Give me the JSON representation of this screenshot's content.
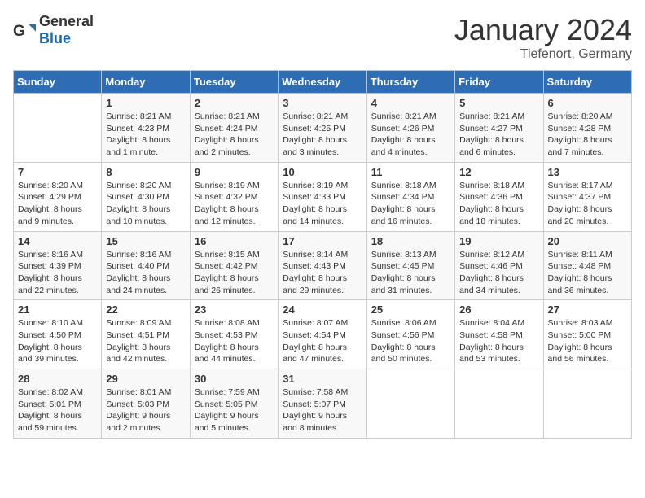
{
  "header": {
    "logo": {
      "general": "General",
      "blue": "Blue"
    },
    "title": "January 2024",
    "subtitle": "Tiefenort, Germany"
  },
  "weekdays": [
    "Sunday",
    "Monday",
    "Tuesday",
    "Wednesday",
    "Thursday",
    "Friday",
    "Saturday"
  ],
  "weeks": [
    [
      {
        "day": "",
        "sunrise": "",
        "sunset": "",
        "daylight": "",
        "empty": true
      },
      {
        "day": "1",
        "sunrise": "Sunrise: 8:21 AM",
        "sunset": "Sunset: 4:23 PM",
        "daylight": "Daylight: 8 hours and 1 minute."
      },
      {
        "day": "2",
        "sunrise": "Sunrise: 8:21 AM",
        "sunset": "Sunset: 4:24 PM",
        "daylight": "Daylight: 8 hours and 2 minutes."
      },
      {
        "day": "3",
        "sunrise": "Sunrise: 8:21 AM",
        "sunset": "Sunset: 4:25 PM",
        "daylight": "Daylight: 8 hours and 3 minutes."
      },
      {
        "day": "4",
        "sunrise": "Sunrise: 8:21 AM",
        "sunset": "Sunset: 4:26 PM",
        "daylight": "Daylight: 8 hours and 4 minutes."
      },
      {
        "day": "5",
        "sunrise": "Sunrise: 8:21 AM",
        "sunset": "Sunset: 4:27 PM",
        "daylight": "Daylight: 8 hours and 6 minutes."
      },
      {
        "day": "6",
        "sunrise": "Sunrise: 8:20 AM",
        "sunset": "Sunset: 4:28 PM",
        "daylight": "Daylight: 8 hours and 7 minutes."
      }
    ],
    [
      {
        "day": "7",
        "sunrise": "Sunrise: 8:20 AM",
        "sunset": "Sunset: 4:29 PM",
        "daylight": "Daylight: 8 hours and 9 minutes."
      },
      {
        "day": "8",
        "sunrise": "Sunrise: 8:20 AM",
        "sunset": "Sunset: 4:30 PM",
        "daylight": "Daylight: 8 hours and 10 minutes."
      },
      {
        "day": "9",
        "sunrise": "Sunrise: 8:19 AM",
        "sunset": "Sunset: 4:32 PM",
        "daylight": "Daylight: 8 hours and 12 minutes."
      },
      {
        "day": "10",
        "sunrise": "Sunrise: 8:19 AM",
        "sunset": "Sunset: 4:33 PM",
        "daylight": "Daylight: 8 hours and 14 minutes."
      },
      {
        "day": "11",
        "sunrise": "Sunrise: 8:18 AM",
        "sunset": "Sunset: 4:34 PM",
        "daylight": "Daylight: 8 hours and 16 minutes."
      },
      {
        "day": "12",
        "sunrise": "Sunrise: 8:18 AM",
        "sunset": "Sunset: 4:36 PM",
        "daylight": "Daylight: 8 hours and 18 minutes."
      },
      {
        "day": "13",
        "sunrise": "Sunrise: 8:17 AM",
        "sunset": "Sunset: 4:37 PM",
        "daylight": "Daylight: 8 hours and 20 minutes."
      }
    ],
    [
      {
        "day": "14",
        "sunrise": "Sunrise: 8:16 AM",
        "sunset": "Sunset: 4:39 PM",
        "daylight": "Daylight: 8 hours and 22 minutes."
      },
      {
        "day": "15",
        "sunrise": "Sunrise: 8:16 AM",
        "sunset": "Sunset: 4:40 PM",
        "daylight": "Daylight: 8 hours and 24 minutes."
      },
      {
        "day": "16",
        "sunrise": "Sunrise: 8:15 AM",
        "sunset": "Sunset: 4:42 PM",
        "daylight": "Daylight: 8 hours and 26 minutes."
      },
      {
        "day": "17",
        "sunrise": "Sunrise: 8:14 AM",
        "sunset": "Sunset: 4:43 PM",
        "daylight": "Daylight: 8 hours and 29 minutes."
      },
      {
        "day": "18",
        "sunrise": "Sunrise: 8:13 AM",
        "sunset": "Sunset: 4:45 PM",
        "daylight": "Daylight: 8 hours and 31 minutes."
      },
      {
        "day": "19",
        "sunrise": "Sunrise: 8:12 AM",
        "sunset": "Sunset: 4:46 PM",
        "daylight": "Daylight: 8 hours and 34 minutes."
      },
      {
        "day": "20",
        "sunrise": "Sunrise: 8:11 AM",
        "sunset": "Sunset: 4:48 PM",
        "daylight": "Daylight: 8 hours and 36 minutes."
      }
    ],
    [
      {
        "day": "21",
        "sunrise": "Sunrise: 8:10 AM",
        "sunset": "Sunset: 4:50 PM",
        "daylight": "Daylight: 8 hours and 39 minutes."
      },
      {
        "day": "22",
        "sunrise": "Sunrise: 8:09 AM",
        "sunset": "Sunset: 4:51 PM",
        "daylight": "Daylight: 8 hours and 42 minutes."
      },
      {
        "day": "23",
        "sunrise": "Sunrise: 8:08 AM",
        "sunset": "Sunset: 4:53 PM",
        "daylight": "Daylight: 8 hours and 44 minutes."
      },
      {
        "day": "24",
        "sunrise": "Sunrise: 8:07 AM",
        "sunset": "Sunset: 4:54 PM",
        "daylight": "Daylight: 8 hours and 47 minutes."
      },
      {
        "day": "25",
        "sunrise": "Sunrise: 8:06 AM",
        "sunset": "Sunset: 4:56 PM",
        "daylight": "Daylight: 8 hours and 50 minutes."
      },
      {
        "day": "26",
        "sunrise": "Sunrise: 8:04 AM",
        "sunset": "Sunset: 4:58 PM",
        "daylight": "Daylight: 8 hours and 53 minutes."
      },
      {
        "day": "27",
        "sunrise": "Sunrise: 8:03 AM",
        "sunset": "Sunset: 5:00 PM",
        "daylight": "Daylight: 8 hours and 56 minutes."
      }
    ],
    [
      {
        "day": "28",
        "sunrise": "Sunrise: 8:02 AM",
        "sunset": "Sunset: 5:01 PM",
        "daylight": "Daylight: 8 hours and 59 minutes."
      },
      {
        "day": "29",
        "sunrise": "Sunrise: 8:01 AM",
        "sunset": "Sunset: 5:03 PM",
        "daylight": "Daylight: 9 hours and 2 minutes."
      },
      {
        "day": "30",
        "sunrise": "Sunrise: 7:59 AM",
        "sunset": "Sunset: 5:05 PM",
        "daylight": "Daylight: 9 hours and 5 minutes."
      },
      {
        "day": "31",
        "sunrise": "Sunrise: 7:58 AM",
        "sunset": "Sunset: 5:07 PM",
        "daylight": "Daylight: 9 hours and 8 minutes."
      },
      {
        "day": "",
        "sunrise": "",
        "sunset": "",
        "daylight": "",
        "empty": true
      },
      {
        "day": "",
        "sunrise": "",
        "sunset": "",
        "daylight": "",
        "empty": true
      },
      {
        "day": "",
        "sunrise": "",
        "sunset": "",
        "daylight": "",
        "empty": true
      }
    ]
  ]
}
